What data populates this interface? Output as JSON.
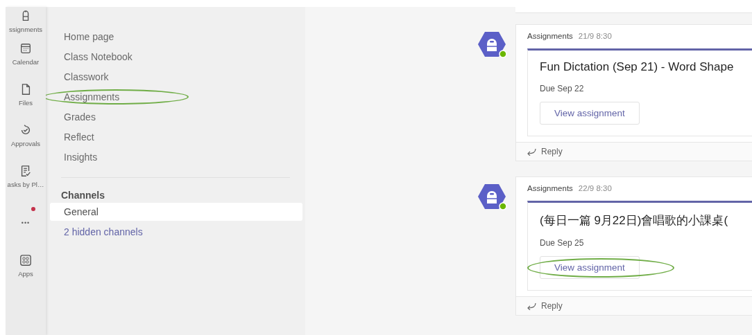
{
  "rail": [
    {
      "kind": "assignments",
      "label": "ssignments",
      "badge": false
    },
    {
      "kind": "calendar",
      "label": "Calendar",
      "badge": false
    },
    {
      "kind": "files",
      "label": "Files",
      "badge": false
    },
    {
      "kind": "approvals",
      "label": "Approvals",
      "badge": false
    },
    {
      "kind": "tasks",
      "label": "asks by Pl…",
      "badge": false
    },
    {
      "kind": "more",
      "label": "•••",
      "badge": true
    },
    {
      "kind": "apps",
      "label": "Apps",
      "badge": false
    }
  ],
  "nav": [
    {
      "label": "Home page",
      "circled": false
    },
    {
      "label": "Class Notebook",
      "circled": false
    },
    {
      "label": "Classwork",
      "circled": false
    },
    {
      "label": "Assignments",
      "circled": true
    },
    {
      "label": "Grades",
      "circled": false
    },
    {
      "label": "Reflect",
      "circled": false
    },
    {
      "label": "Insights",
      "circled": false
    }
  ],
  "channels": {
    "title": "Channels",
    "items": [
      {
        "label": "General",
        "selected": true
      }
    ],
    "hidden_link": "2 hidden channels"
  },
  "messages": [
    {
      "sender": "Assignments",
      "time": "21/9 8:30",
      "title": "Fun Dictation (Sep 21) - Word Shape",
      "due": "Due Sep 22",
      "button": "View assignment",
      "button_circled": false,
      "reply": "Reply"
    },
    {
      "sender": "Assignments",
      "time": "22/9 8:30",
      "title": "(每日一篇 9月22日)會唱歌的小課桌(",
      "due": "Due Sep 25",
      "button": "View assignment",
      "button_circled": true,
      "reply": "Reply"
    }
  ]
}
